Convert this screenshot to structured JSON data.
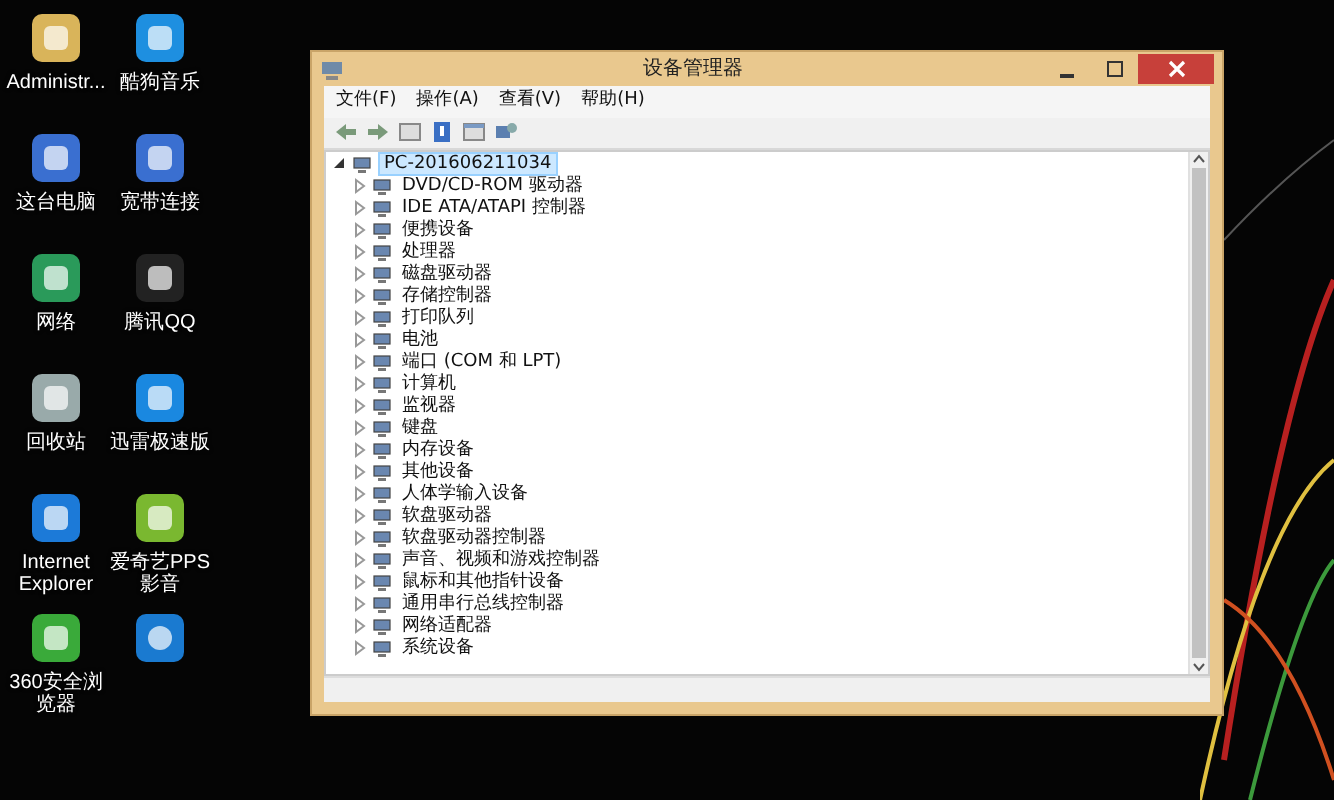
{
  "desktop_icons": [
    {
      "label": "Administr..."
    },
    {
      "label": "酷狗音乐"
    },
    {
      "label": "这台电脑"
    },
    {
      "label": "宽带连接"
    },
    {
      "label": "网络"
    },
    {
      "label": "腾讯QQ"
    },
    {
      "label": "回收站"
    },
    {
      "label": "迅雷极速版"
    },
    {
      "label": "Internet Explorer"
    },
    {
      "label": "爱奇艺PPS 影音"
    },
    {
      "label": "360安全浏览器"
    }
  ],
  "window": {
    "title": "设备管理器",
    "menu": [
      "文件(F)",
      "操作(A)",
      "查看(V)",
      "帮助(H)"
    ],
    "tree": [
      {
        "label": "PC-201606211034",
        "expanded": true,
        "selected": true,
        "children": [
          {
            "label": "DVD/CD-ROM 驱动器",
            "expanded": false,
            "selected": false
          },
          {
            "label": "IDE ATA/ATAPI 控制器",
            "expanded": false,
            "selected": false
          },
          {
            "label": "便携设备",
            "expanded": false,
            "selected": false
          },
          {
            "label": "处理器",
            "expanded": false,
            "selected": false
          },
          {
            "label": "磁盘驱动器",
            "expanded": false,
            "selected": false
          },
          {
            "label": "存储控制器",
            "expanded": false,
            "selected": false
          },
          {
            "label": "打印队列",
            "expanded": false,
            "selected": false
          },
          {
            "label": "电池",
            "expanded": false,
            "selected": false
          },
          {
            "label": "端口 (COM 和 LPT)",
            "expanded": false,
            "selected": false
          },
          {
            "label": "计算机",
            "expanded": false,
            "selected": false
          },
          {
            "label": "监视器",
            "expanded": false,
            "selected": false
          },
          {
            "label": "键盘",
            "expanded": false,
            "selected": false
          },
          {
            "label": "内存设备",
            "expanded": false,
            "selected": false
          },
          {
            "label": "其他设备",
            "expanded": false,
            "selected": false
          },
          {
            "label": "人体学输入设备",
            "expanded": false,
            "selected": false
          },
          {
            "label": "软盘驱动器",
            "expanded": false,
            "selected": false
          },
          {
            "label": "软盘驱动器控制器",
            "expanded": false,
            "selected": false
          },
          {
            "label": "声音、视频和游戏控制器",
            "expanded": false,
            "selected": false
          },
          {
            "label": "鼠标和其他指针设备",
            "expanded": false,
            "selected": false
          },
          {
            "label": "通用串行总线控制器",
            "expanded": false,
            "selected": false
          },
          {
            "label": "网络适配器",
            "expanded": false,
            "selected": false
          },
          {
            "label": "系统设备",
            "expanded": false,
            "selected": false
          }
        ]
      }
    ]
  }
}
